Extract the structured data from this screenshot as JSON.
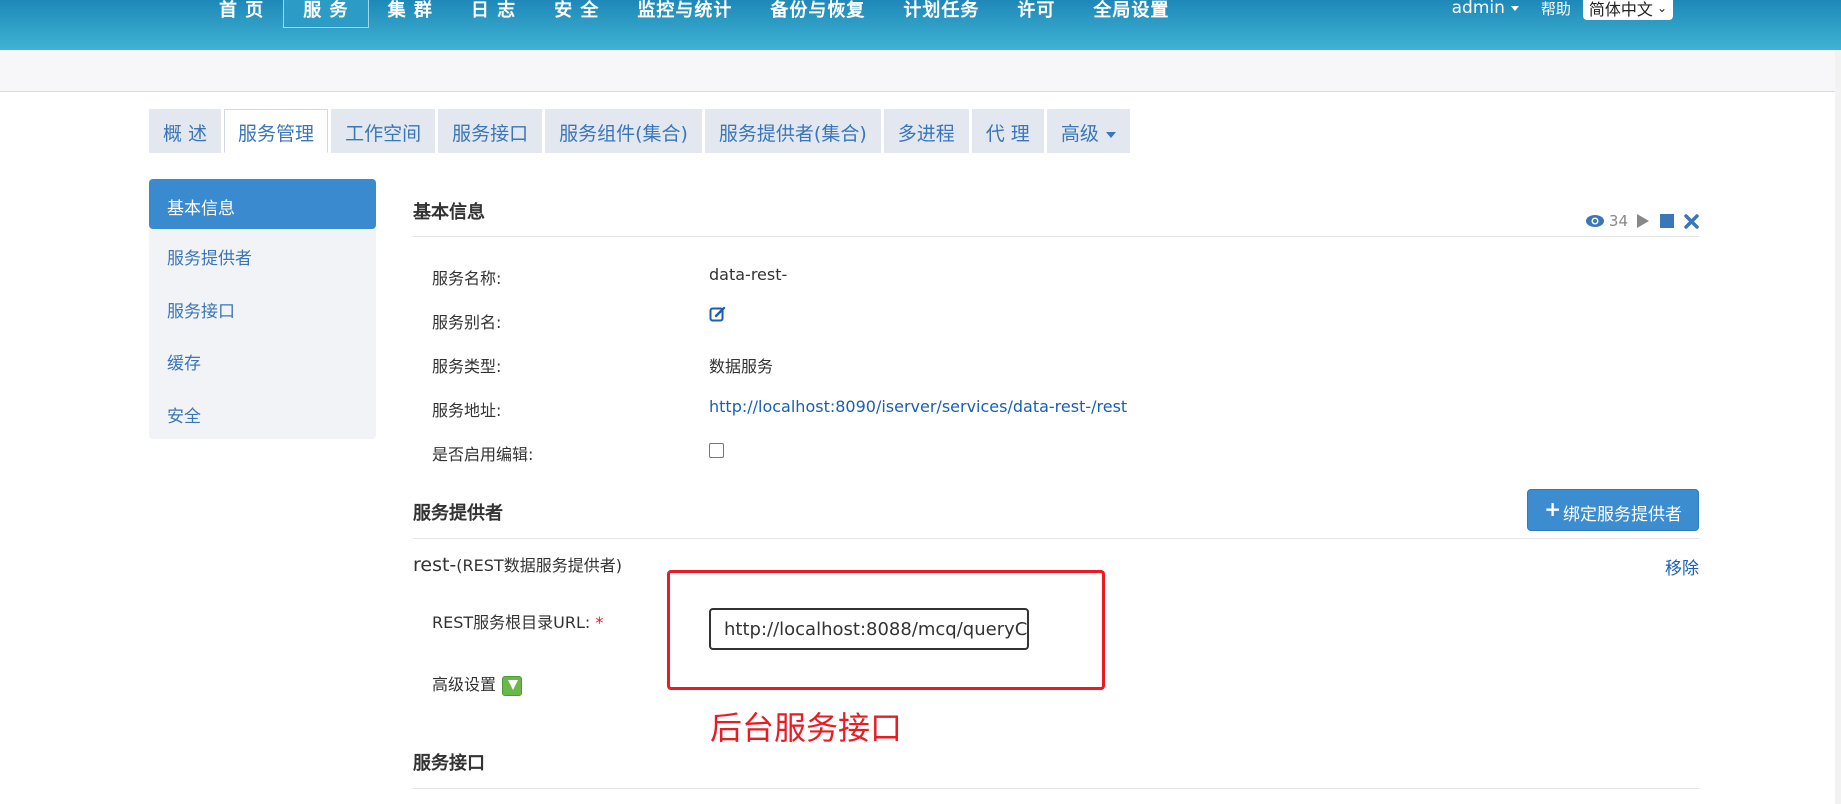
{
  "topnav": {
    "items": [
      "首 页",
      "服 务",
      "集 群",
      "日 志",
      "安 全",
      "监控与统计",
      "备份与恢复",
      "计划任务",
      "许可",
      "全局设置"
    ],
    "active_index": 1
  },
  "user": {
    "name": "admin",
    "help": "帮助",
    "language": "简体中文"
  },
  "tabs": {
    "items": [
      "概 述",
      "服务管理",
      "工作空间",
      "服务接口",
      "服务组件(集合)",
      "服务提供者(集合)",
      "多进程",
      "代 理",
      "高级"
    ],
    "active_index": 1
  },
  "sidebar": {
    "items": [
      "基本信息",
      "服务提供者",
      "服务接口",
      "缓存",
      "安全"
    ],
    "active_index": 0
  },
  "basic": {
    "title": "基本信息",
    "view_count": "34",
    "rows": [
      {
        "label": "服务名称:",
        "value": "data-rest-"
      },
      {
        "label": "服务别名:",
        "value": ""
      },
      {
        "label": "服务类型:",
        "value": "数据服务"
      },
      {
        "label": "服务地址:",
        "value": "http://localhost:8090/iserver/services/data-rest-/rest"
      },
      {
        "label": "是否启用编辑:",
        "value": ""
      }
    ]
  },
  "provider": {
    "title": "服务提供者",
    "bind_button": "绑定服务提供者",
    "name": "rest-",
    "type": "(REST数据服务提供者)",
    "remove": "移除",
    "url_label": "REST服务根目录URL:",
    "required_mark": "*",
    "url_value": "http://localhost:8088/mcq/queryC",
    "advanced_label": "高级设置"
  },
  "annotation": {
    "text": "后台服务接口",
    "color": "#ea1b23"
  },
  "interfaces": {
    "title": "服务接口"
  },
  "colors": {
    "accent": "#3a8ad0",
    "link": "#1a5fb4",
    "topbar": "#2c9cc7"
  }
}
